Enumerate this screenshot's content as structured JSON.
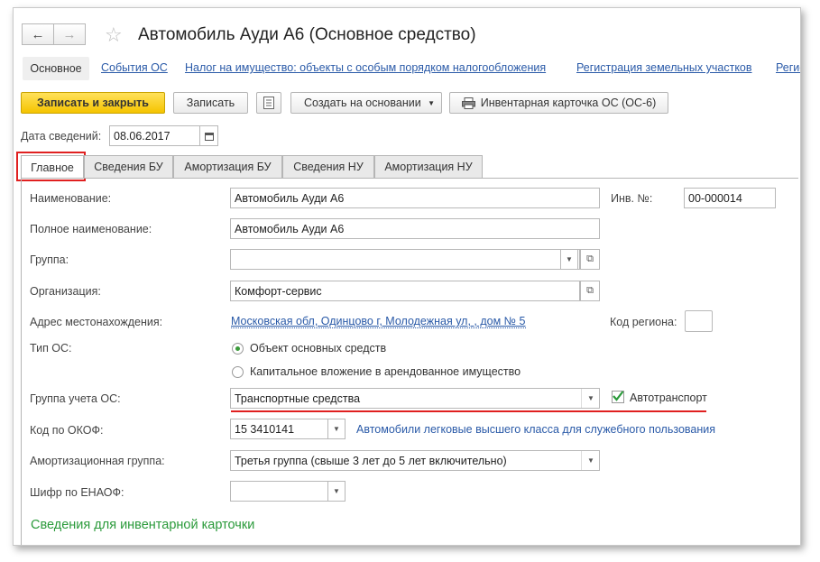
{
  "window": {
    "title": "Автомобиль Ауди А6 (Основное средство)"
  },
  "nav": {
    "back_icon": "arrow-left-icon",
    "forward_icon": "arrow-right-icon",
    "star_icon": "star-icon"
  },
  "topnav": {
    "items": [
      {
        "label": "Основное"
      },
      {
        "label": "События ОС"
      },
      {
        "label": "Налог на имущество: объекты с особым порядком налогообложения"
      },
      {
        "label": "Регистрация земельных участков"
      },
      {
        "label": "Регис"
      }
    ]
  },
  "toolbar": {
    "save_close_label": "Записать и закрыть",
    "save_label": "Записать",
    "create_based_label": "Создать на основании",
    "inventory_card_label": "Инвентарная карточка ОС (ОС-6)"
  },
  "info_date": {
    "label": "Дата сведений:",
    "value": "08.06.2017"
  },
  "tabs": [
    {
      "label": "Главное"
    },
    {
      "label": "Сведения БУ"
    },
    {
      "label": "Амортизация БУ"
    },
    {
      "label": "Сведения НУ"
    },
    {
      "label": "Амортизация НУ"
    }
  ],
  "form": {
    "name_label": "Наименование:",
    "name_value": "Автомобиль Ауди А6",
    "inv_label": "Инв. №:",
    "inv_value": "00-000014",
    "full_name_label": "Полное наименование:",
    "full_name_value": "Автомобиль Ауди А6",
    "group_label": "Группа:",
    "group_value": "",
    "org_label": "Организация:",
    "org_value": "Комфорт-сервис",
    "address_label": "Адрес местонахождения:",
    "address_value": "Московская обл, Одинцово г, Молодежная ул, , дом № 5",
    "region_label": "Код региона:",
    "region_value": "",
    "os_type_label": "Тип ОС:",
    "os_type_options": [
      {
        "label": "Объект основных средств",
        "selected": true
      },
      {
        "label": "Капитальное вложение в арендованное имущество",
        "selected": false
      }
    ],
    "account_group_label": "Группа учета ОС:",
    "account_group_value": "Транспортные средства",
    "autotransport_label": "Автотранспорт",
    "autotransport_checked": true,
    "okof_label": "Код по ОКОФ:",
    "okof_value": "15 3410141",
    "okof_description": "Автомобили легковые высшего класса для служебного пользования",
    "amort_group_label": "Амортизационная группа:",
    "amort_group_value": "Третья группа (свыше 3 лет до 5 лет включительно)",
    "enaof_label": "Шифр по ЕНАОФ:",
    "enaof_value": "",
    "section_title": "Сведения для инвентарной карточки"
  },
  "colors": {
    "accent_yellow": "#f5c400",
    "link_blue": "#2a5aa8",
    "section_green": "#2a9a3a",
    "highlight_red": "#e02020"
  }
}
